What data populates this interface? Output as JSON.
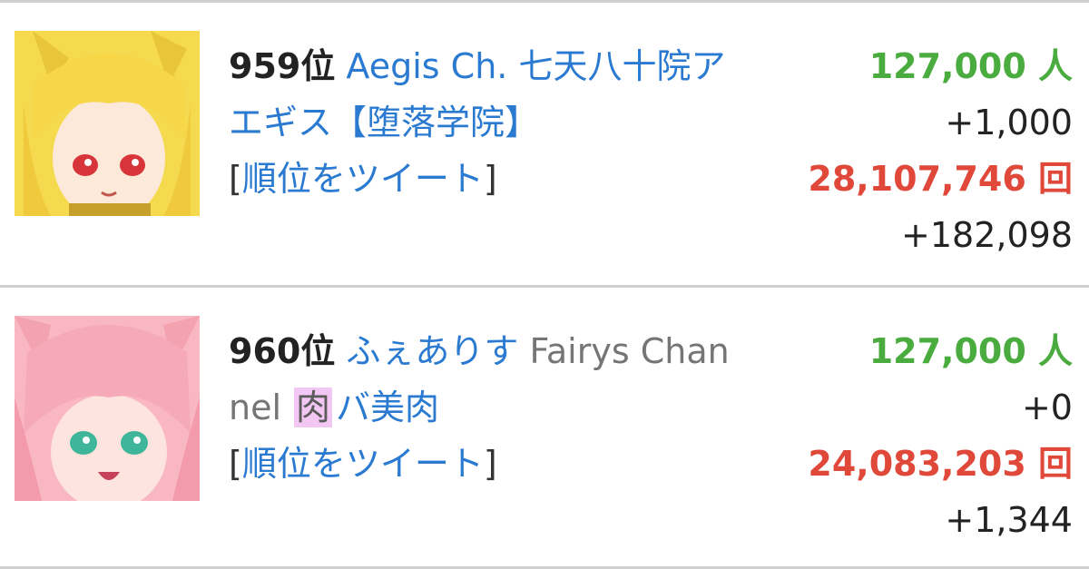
{
  "entries": [
    {
      "rank": "959位",
      "name_line1": "Aegis Ch. 七天八十院ア",
      "name_line2": "エギス【堕落学院】",
      "tweet_open": "[",
      "tweet_label": "順位をツイート",
      "tweet_close": "]",
      "subscribers": "127,000 人",
      "subscribers_delta": "+1,000",
      "views": "28,107,746 回",
      "views_delta": "+182,098"
    },
    {
      "rank": "960位",
      "name_jp": "ふぇありす",
      "name_en_part1": "Fairys Chan",
      "name_en_part2": "nel",
      "badge": "肉",
      "name_suffix": "バ美肉",
      "tweet_open": "[",
      "tweet_label": "順位をツイート",
      "tweet_close": "]",
      "subscribers": "127,000 人",
      "subscribers_delta": "+0",
      "views": "24,083,203 回",
      "views_delta": "+1,344"
    }
  ],
  "colors": {
    "link": "#2a7ad1",
    "subscribers": "#4aab3e",
    "views": "#e0483a",
    "badge_bg": "#f3c7f3"
  }
}
